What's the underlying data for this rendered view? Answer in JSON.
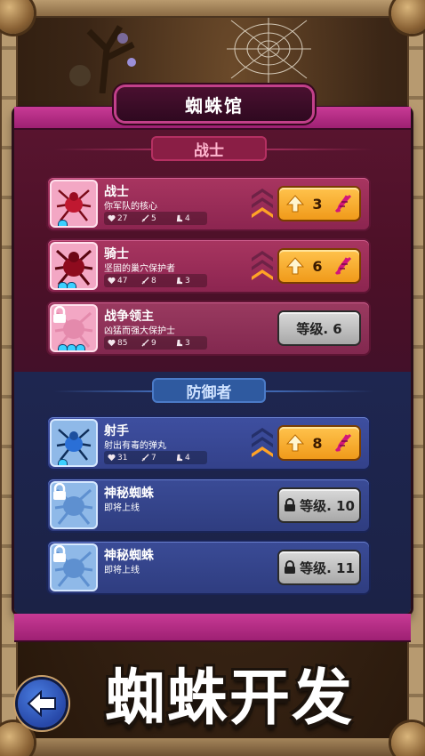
{
  "header": {
    "title": "蜘蛛馆"
  },
  "sections": [
    {
      "label": "战士",
      "cards": [
        {
          "name": "战士",
          "desc": "你军队的核心",
          "stats": [
            "27",
            "5",
            "4"
          ],
          "action": {
            "type": "upgrade",
            "cost": "3"
          },
          "pips": 1
        },
        {
          "name": "骑士",
          "desc": "坚固的巢穴保护者",
          "stats": [
            "47",
            "8",
            "3"
          ],
          "action": {
            "type": "upgrade",
            "cost": "6"
          },
          "pips": 2
        },
        {
          "name": "战争领主",
          "desc": "凶猛而强大保护士",
          "stats": [
            "85",
            "9",
            "3"
          ],
          "action": {
            "type": "level",
            "label": "等级. 6"
          },
          "pips": 3
        }
      ]
    },
    {
      "label": "防御者",
      "cards": [
        {
          "name": "射手",
          "desc": "射出有毒的弹丸",
          "stats": [
            "31",
            "7",
            "4"
          ],
          "action": {
            "type": "upgrade",
            "cost": "8"
          },
          "pips": 1
        },
        {
          "name": "神秘蜘蛛",
          "desc": "即将上线",
          "action": {
            "type": "level",
            "label": "等级. 10"
          }
        },
        {
          "name": "神秘蜘蛛",
          "desc": "即将上线",
          "action": {
            "type": "level",
            "label": "等级. 11"
          }
        }
      ]
    }
  ],
  "banner": "蜘蛛开发",
  "icons": {
    "back": "back-arrow-icon",
    "health": "heart-icon",
    "attack": "sword-icon",
    "speed": "boot-icon",
    "upgrade": "up-arrow-icon",
    "currency": "dna-icon",
    "lock": "lock-icon"
  },
  "colors": {
    "warrior_card": "#a83560",
    "defender_card": "#3e4fa0",
    "upgrade_button": "#ffc34d",
    "level_button": "#c4c4c4"
  }
}
